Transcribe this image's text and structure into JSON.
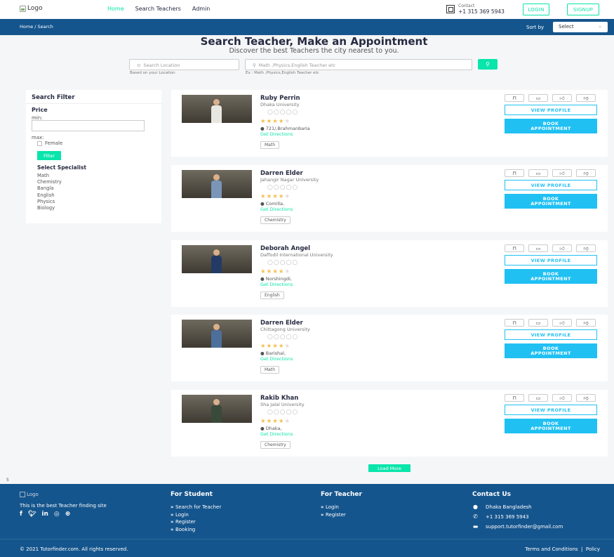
{
  "header": {
    "logo_alt": "Logo",
    "nav": [
      "Home",
      "Search Teachers",
      "Admin"
    ],
    "contact_label": "Contact",
    "contact_phone": "+1 315 369 5943",
    "login": "LOGIN",
    "signup": "SIGNUP"
  },
  "breadcrumb": {
    "path": "Home / Search",
    "sort_label": "Sort by",
    "sort_value": "Select"
  },
  "hero": {
    "title": "Search Teacher, Make an Appointment",
    "subtitle": "Discover the best Teachers the city nearest to you.",
    "location_placeholder": "Search Location",
    "location_hint": "Based on your Location",
    "subject_placeholder": "Math ,Physics,English Teacher etc",
    "subject_hint": "Ex : Math ,Physics,English Teacher etc"
  },
  "filter": {
    "title": "Search Filter",
    "price_label": "Price",
    "min_label": "min:",
    "max_label": "max:",
    "female_label": "Female",
    "filter_button": "Filter",
    "specialist_title": "Select Specialist",
    "specialists": [
      "Math",
      "Chemistry",
      "Bangla",
      "English",
      "Physics",
      "Biology"
    ]
  },
  "teachers": [
    {
      "name": "Ruby Perrin",
      "university": "Dhaka University",
      "rating": 4,
      "location": "721/,Brahmanbaria",
      "directions": "Get Directions",
      "subject": "Math",
      "shirt": "#e8e6e0"
    },
    {
      "name": "Darren Elder",
      "university": "Jahangir Nagar University",
      "rating": 4,
      "location": "Comilla,",
      "directions": "Get Directions",
      "subject": "Chemistry",
      "shirt": "#7a95b8"
    },
    {
      "name": "Deborah Angel",
      "university": "Daffodil International University",
      "rating": 4,
      "location": "Norshingdi,",
      "directions": "Get Directions",
      "subject": "English",
      "shirt": "#233a66"
    },
    {
      "name": "Darren Elder",
      "university": "Chittagong University",
      "rating": 4,
      "location": "Barishal,",
      "directions": "Get Directions",
      "subject": "Math",
      "shirt": "#4d6f9c"
    },
    {
      "name": "Rakib Khan",
      "university": "Sha Jalal University",
      "rating": 4,
      "location": "Dhaka,",
      "directions": "Get Directions",
      "subject": "Chemistry",
      "shirt": "#3a4a3a"
    }
  ],
  "card_actions": {
    "view_profile": "VIEW PROFILE",
    "book_line1": "BOOK",
    "book_line2": "APPOINTMENT",
    "icons": [
      "bookmark-icon",
      "comment-icon",
      "thumbs-up-icon",
      "thumbs-down-icon"
    ]
  },
  "load_more": "Load More",
  "stray_text": "5",
  "footer": {
    "logo_alt": "Logo",
    "about": "This is the best Teacher finding site",
    "social": [
      "f",
      "t",
      "in",
      "ig",
      "dr"
    ],
    "student_title": "For Student",
    "student_links": [
      "Search for Teacher",
      "Login",
      "Register",
      "Booking"
    ],
    "teacher_title": "For Teacher",
    "teacher_links": [
      "Login",
      "Register"
    ],
    "contact_title": "Contact Us",
    "address": "Dhaka Bangladesh",
    "phone": "+1 315 369 5943",
    "email": "support.tutorfinder@gmail.com",
    "copyright": "© 2021 Tutorfinder.com. All rights reserved.",
    "terms": "Terms and Conditions",
    "policy": "Policy"
  },
  "colors": {
    "accent_green": "#09e5ab",
    "accent_blue": "#20c0f3",
    "brand_navy": "#15558d",
    "star": "#f4c150"
  }
}
